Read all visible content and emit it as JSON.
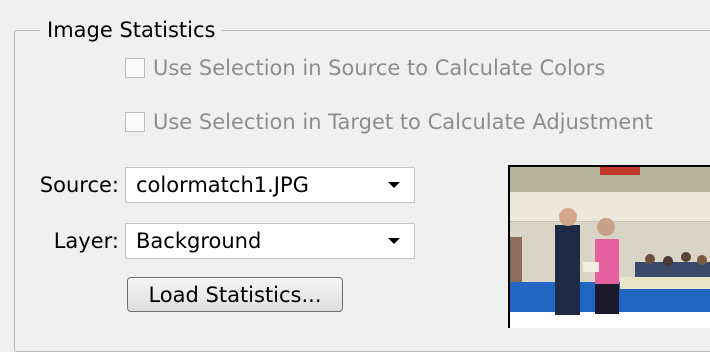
{
  "group": {
    "title": "Image Statistics"
  },
  "options": {
    "use_source_selection": {
      "label": "Use Selection in Source to Calculate Colors",
      "checked": false,
      "enabled": false
    },
    "use_target_selection": {
      "label": "Use Selection in Target to Calculate Adjustment",
      "checked": false,
      "enabled": false
    }
  },
  "source": {
    "label": "Source:",
    "value": "colormatch1.JPG"
  },
  "layer": {
    "label": "Layer:",
    "value": "Background"
  },
  "load_button": {
    "label": "Load Statistics..."
  }
}
